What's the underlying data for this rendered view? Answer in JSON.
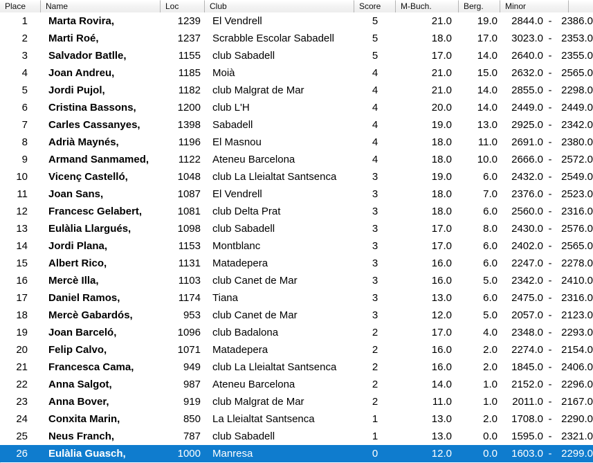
{
  "table": {
    "columns": [
      {
        "key": "place",
        "label": "Place"
      },
      {
        "key": "name",
        "label": "Name"
      },
      {
        "key": "loc",
        "label": "Loc"
      },
      {
        "key": "club",
        "label": "Club"
      },
      {
        "key": "score",
        "label": "Score"
      },
      {
        "key": "mbuch",
        "label": "M-Buch."
      },
      {
        "key": "berg",
        "label": "Berg."
      },
      {
        "key": "minor",
        "label": "Minor"
      }
    ],
    "separator": "-",
    "selected_index": 25,
    "colors": {
      "selection_background": "#0f7cce",
      "selection_text": "#ffffff",
      "header_background": "#f0f0f0",
      "row_background": "#ffffff",
      "text": "#000000"
    },
    "rows": [
      {
        "place": "1",
        "name": "Marta Rovira,",
        "loc": "1239",
        "club": "El Vendrell",
        "score": "5",
        "mbuch": "21.0",
        "berg": "19.0",
        "minor1": "2844.0",
        "minor2": "2386.0"
      },
      {
        "place": "2",
        "name": "Marti Roé,",
        "loc": "1237",
        "club": "Scrabble Escolar Sabadell",
        "score": "5",
        "mbuch": "18.0",
        "berg": "17.0",
        "minor1": "3023.0",
        "minor2": "2353.0"
      },
      {
        "place": "3",
        "name": "Salvador Batlle,",
        "loc": "1155",
        "club": "club Sabadell",
        "score": "5",
        "mbuch": "17.0",
        "berg": "14.0",
        "minor1": "2640.0",
        "minor2": "2355.0"
      },
      {
        "place": "4",
        "name": "Joan Andreu,",
        "loc": "1185",
        "club": "Moià",
        "score": "4",
        "mbuch": "21.0",
        "berg": "15.0",
        "minor1": "2632.0",
        "minor2": "2565.0"
      },
      {
        "place": "5",
        "name": "Jordi Pujol,",
        "loc": "1182",
        "club": "club Malgrat de Mar",
        "score": "4",
        "mbuch": "21.0",
        "berg": "14.0",
        "minor1": "2855.0",
        "minor2": "2298.0"
      },
      {
        "place": "6",
        "name": "Cristina Bassons,",
        "loc": "1200",
        "club": "club L'H",
        "score": "4",
        "mbuch": "20.0",
        "berg": "14.0",
        "minor1": "2449.0",
        "minor2": "2449.0"
      },
      {
        "place": "7",
        "name": "Carles Cassanyes,",
        "loc": "1398",
        "club": "Sabadell",
        "score": "4",
        "mbuch": "19.0",
        "berg": "13.0",
        "minor1": "2925.0",
        "minor2": "2342.0"
      },
      {
        "place": "8",
        "name": "Adrià Maynés,",
        "loc": "1196",
        "club": "El Masnou",
        "score": "4",
        "mbuch": "18.0",
        "berg": "11.0",
        "minor1": "2691.0",
        "minor2": "2380.0"
      },
      {
        "place": "9",
        "name": "Armand Sanmamed,",
        "loc": "1122",
        "club": "Ateneu Barcelona",
        "score": "4",
        "mbuch": "18.0",
        "berg": "10.0",
        "minor1": "2666.0",
        "minor2": "2572.0"
      },
      {
        "place": "10",
        "name": "Vicenç Castelló,",
        "loc": "1048",
        "club": "club La Lleialtat Santsenca",
        "score": "3",
        "mbuch": "19.0",
        "berg": "6.0",
        "minor1": "2432.0",
        "minor2": "2549.0"
      },
      {
        "place": "11",
        "name": "Joan Sans,",
        "loc": "1087",
        "club": "El Vendrell",
        "score": "3",
        "mbuch": "18.0",
        "berg": "7.0",
        "minor1": "2376.0",
        "minor2": "2523.0"
      },
      {
        "place": "12",
        "name": "Francesc Gelabert,",
        "loc": "1081",
        "club": "club Delta Prat",
        "score": "3",
        "mbuch": "18.0",
        "berg": "6.0",
        "minor1": "2560.0",
        "minor2": "2316.0"
      },
      {
        "place": "13",
        "name": "Eulàlia Llargués,",
        "loc": "1098",
        "club": "club Sabadell",
        "score": "3",
        "mbuch": "17.0",
        "berg": "8.0",
        "minor1": "2430.0",
        "minor2": "2576.0"
      },
      {
        "place": "14",
        "name": "Jordi Plana,",
        "loc": "1153",
        "club": "Montblanc",
        "score": "3",
        "mbuch": "17.0",
        "berg": "6.0",
        "minor1": "2402.0",
        "minor2": "2565.0"
      },
      {
        "place": "15",
        "name": "Albert Rico,",
        "loc": "1131",
        "club": "Matadepera",
        "score": "3",
        "mbuch": "16.0",
        "berg": "6.0",
        "minor1": "2247.0",
        "minor2": "2278.0"
      },
      {
        "place": "16",
        "name": "Mercè Illa,",
        "loc": "1103",
        "club": "club Canet de Mar",
        "score": "3",
        "mbuch": "16.0",
        "berg": "5.0",
        "minor1": "2342.0",
        "minor2": "2410.0"
      },
      {
        "place": "17",
        "name": "Daniel Ramos,",
        "loc": "1174",
        "club": "Tiana",
        "score": "3",
        "mbuch": "13.0",
        "berg": "6.0",
        "minor1": "2475.0",
        "minor2": "2316.0"
      },
      {
        "place": "18",
        "name": "Mercè Gabardós,",
        "loc": "953",
        "club": "club Canet de Mar",
        "score": "3",
        "mbuch": "12.0",
        "berg": "5.0",
        "minor1": "2057.0",
        "minor2": "2123.0"
      },
      {
        "place": "19",
        "name": "Joan Barceló,",
        "loc": "1096",
        "club": "club Badalona",
        "score": "2",
        "mbuch": "17.0",
        "berg": "4.0",
        "minor1": "2348.0",
        "minor2": "2293.0"
      },
      {
        "place": "20",
        "name": "Felip Calvo,",
        "loc": "1071",
        "club": "Matadepera",
        "score": "2",
        "mbuch": "16.0",
        "berg": "2.0",
        "minor1": "2274.0",
        "minor2": "2154.0"
      },
      {
        "place": "21",
        "name": "Francesca Cama,",
        "loc": "949",
        "club": "club La Lleialtat Santsenca",
        "score": "2",
        "mbuch": "16.0",
        "berg": "2.0",
        "minor1": "1845.0",
        "minor2": "2406.0"
      },
      {
        "place": "22",
        "name": "Anna Salgot,",
        "loc": "987",
        "club": "Ateneu Barcelona",
        "score": "2",
        "mbuch": "14.0",
        "berg": "1.0",
        "minor1": "2152.0",
        "minor2": "2296.0"
      },
      {
        "place": "23",
        "name": "Anna Bover,",
        "loc": "919",
        "club": "club Malgrat de Mar",
        "score": "2",
        "mbuch": "11.0",
        "berg": "1.0",
        "minor1": "2011.0",
        "minor2": "2167.0"
      },
      {
        "place": "24",
        "name": "Conxita Marin,",
        "loc": "850",
        "club": "La Lleialtat Santsenca",
        "score": "1",
        "mbuch": "13.0",
        "berg": "2.0",
        "minor1": "1708.0",
        "minor2": "2290.0"
      },
      {
        "place": "25",
        "name": "Neus Franch,",
        "loc": "787",
        "club": "club Sabadell",
        "score": "1",
        "mbuch": "13.0",
        "berg": "0.0",
        "minor1": "1595.0",
        "minor2": "2321.0"
      },
      {
        "place": "26",
        "name": "Eulàlia Guasch,",
        "loc": "1000",
        "club": "Manresa",
        "score": "0",
        "mbuch": "12.0",
        "berg": "0.0",
        "minor1": "1603.0",
        "minor2": "2299.0"
      }
    ]
  }
}
